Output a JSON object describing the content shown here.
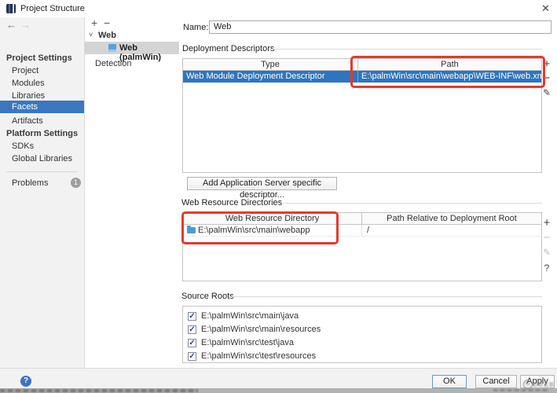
{
  "window": {
    "title": "Project Structure"
  },
  "icons": {
    "close": "✕",
    "back": "←",
    "forward": "→",
    "plus": "+",
    "minus": "−",
    "edit": "✎",
    "question": "?",
    "chevron_down": "˅",
    "check": "✓",
    "help": "?",
    "wm_logo": "G"
  },
  "sidebar": {
    "section1_header": "Project Settings",
    "items1": [
      "Project",
      "Modules",
      "Libraries",
      "Facets",
      "Artifacts"
    ],
    "selected_item": "Facets",
    "section2_header": "Platform Settings",
    "items2": [
      "SDKs",
      "Global Libraries"
    ],
    "problems": {
      "label": "Problems",
      "badge": "1"
    }
  },
  "tree": {
    "root": "Web",
    "selected_child": "Web (palmWin)",
    "item2": "Detection"
  },
  "main": {
    "name_label": "Name:",
    "name_value": "Web",
    "deployment": {
      "section": "Deployment Descriptors",
      "col_type": "Type",
      "col_path": "Path",
      "rows": [
        {
          "type": "Web Module Deployment Descriptor",
          "path": "E:\\palmWin\\src\\main\\webapp\\WEB-INF\\web.xml"
        }
      ]
    },
    "add_descriptor_button": "Add Application Server specific descriptor...",
    "web_resources": {
      "section": "Web Resource Directories",
      "col_dir": "Web Resource Directory",
      "col_rel": "Path Relative to Deployment Root",
      "rows": [
        {
          "directory": "E:\\palmWin\\src\\main\\webapp",
          "path": "/"
        }
      ]
    },
    "source_roots": {
      "section": "Source Roots",
      "items": [
        "E:\\palmWin\\src\\main\\java",
        "E:\\palmWin\\src\\main\\resources",
        "E:\\palmWin\\src\\test\\java",
        "E:\\palmWin\\src\\test\\resources"
      ]
    }
  },
  "footer": {
    "ok": "OK",
    "cancel": "Cancel",
    "apply": "Apply"
  },
  "watermark": {
    "text": "创新互联"
  },
  "colors": {
    "selection_blue": "#2e75bf",
    "sidebar_selection": "#3a77bf",
    "annotation_red": "#e8382a",
    "sidebar_bg": "#f2f2f2"
  }
}
